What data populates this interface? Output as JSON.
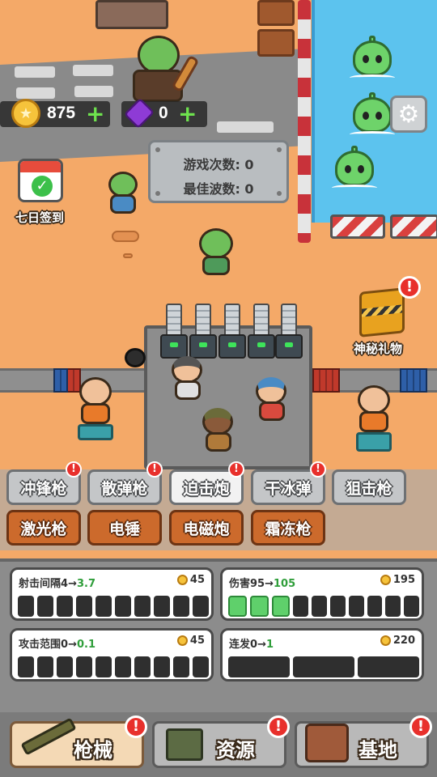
{
  "hud": {
    "coins": "875",
    "gems": "0",
    "plus": "+"
  },
  "stats": {
    "games_played": "游戏次数:  0",
    "best_wave": "最佳波数:  0"
  },
  "daily_checkin": {
    "label": "七日签到",
    "icon": "calendar-check-icon"
  },
  "mystery_gift": {
    "label": "神秘礼物",
    "icon": "gift-box-icon",
    "alert": "!"
  },
  "settings": {
    "icon": "gear-icon"
  },
  "weapon_tabs": [
    {
      "label": "冲锋枪",
      "style": "gray",
      "alert": "!"
    },
    {
      "label": "散弹枪",
      "style": "gray",
      "alert": "!"
    },
    {
      "label": "迫击炮",
      "style": "active",
      "alert": "!"
    },
    {
      "label": "干冰弹",
      "style": "gray",
      "alert": "!"
    },
    {
      "label": "狙击枪",
      "style": "gray",
      "alert": ""
    },
    {
      "label": "激光枪",
      "style": "brown",
      "alert": ""
    },
    {
      "label": "电锤",
      "style": "brown",
      "alert": ""
    },
    {
      "label": "电磁炮",
      "style": "brown",
      "alert": ""
    },
    {
      "label": "霜冻枪",
      "style": "brown",
      "alert": ""
    }
  ],
  "upgrades": [
    {
      "name": "射击间隔",
      "current": "4",
      "arrow": "→",
      "next": "3.7",
      "cost": "45",
      "filled": 0,
      "total": 10
    },
    {
      "name": "伤害",
      "current": "95",
      "arrow": "→",
      "next": "105",
      "cost": "195",
      "filled": 3,
      "total": 10
    },
    {
      "name": "攻击范围",
      "current": "0",
      "arrow": "→",
      "next": "0.1",
      "cost": "45",
      "filled": 0,
      "total": 10
    },
    {
      "name": "连发",
      "current": "0",
      "arrow": "→",
      "next": "1",
      "cost": "220",
      "filled": 0,
      "total": 3
    }
  ],
  "nav": [
    {
      "label": "枪械",
      "icon": "rifle-icon",
      "alert": "!"
    },
    {
      "label": "资源",
      "icon": "resource-crate-icon",
      "alert": "!"
    },
    {
      "label": "基地",
      "icon": "base-building-icon",
      "alert": "!"
    }
  ],
  "colors": {
    "ground": "#f4a968",
    "water": "#5cc3ee",
    "progress_fill": "#5fd06b",
    "alert": "#e8302c",
    "upgrade_value": "#2f9e3a"
  }
}
